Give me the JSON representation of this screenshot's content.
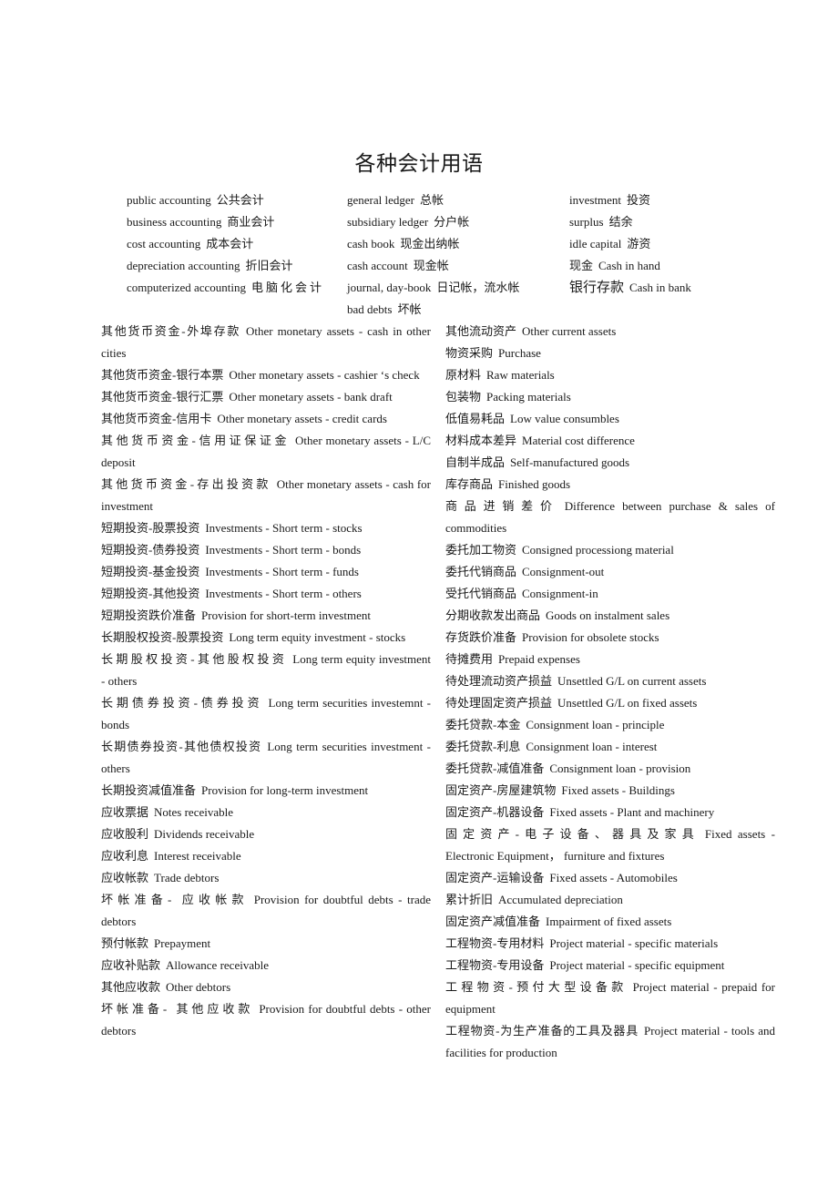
{
  "title": "各种会计用语",
  "top_terms": {
    "col1": [
      {
        "en": "public accounting",
        "zh": "公共会计"
      },
      {
        "en": "business accounting",
        "zh": "商业会计"
      },
      {
        "en": "cost accounting",
        "zh": "成本会计"
      },
      {
        "en": "depreciation accounting",
        "zh": "折旧会计"
      },
      {
        "en": "computerized accounting",
        "zh": "电脑化会计"
      }
    ],
    "col2": [
      {
        "en": "general ledger",
        "zh": "总帐"
      },
      {
        "en": "subsidiary ledger",
        "zh": "分户帐"
      },
      {
        "en": "cash book",
        "zh": "现金出纳帐"
      },
      {
        "en": "cash account",
        "zh": "现金帐"
      },
      {
        "en": "journal, day-book",
        "zh": "日记帐，流水帐"
      },
      {
        "en": "bad debts",
        "zh": "坏帐"
      }
    ],
    "col3": [
      {
        "en": "investment",
        "zh": "投资"
      },
      {
        "en": "surplus",
        "zh": "结余"
      },
      {
        "en": "idle capital",
        "zh": "游资"
      },
      {
        "zh": "现金",
        "en": "Cash in hand"
      },
      {
        "zh": "银行存款",
        "en": "Cash in bank"
      }
    ]
  },
  "left_entries": [
    {
      "zh": "其他货币资金-外埠存款",
      "en": "Other monetary assets - cash in other cities"
    },
    {
      "zh": "其他货币资金-银行本票",
      "en": "Other monetary assets - cashier ‘s check"
    },
    {
      "zh": "其他货币资金-银行汇票",
      "en": "Other monetary assets - bank draft"
    },
    {
      "zh": "其他货币资金-信用卡",
      "en": "Other monetary assets - credit cards"
    },
    {
      "zh": "其他货币资金-信用证保证金",
      "en": "Other monetary assets - L/C deposit"
    },
    {
      "zh": "其他货币资金-存出投资款",
      "en": "Other monetary assets - cash for investment"
    },
    {
      "zh": "短期投资-股票投资",
      "en": "Investments - Short term - stocks"
    },
    {
      "zh": "短期投资-债券投资",
      "en": "Investments - Short term - bonds"
    },
    {
      "zh": "短期投资-基金投资",
      "en": "Investments - Short term - funds"
    },
    {
      "zh": "短期投资-其他投资",
      "en": "Investments - Short term - others"
    },
    {
      "zh": "短期投资跌价准备",
      "en": "Provision for short-term investment"
    },
    {
      "zh": "长期股权投资-股票投资",
      "en": "Long term equity investment - stocks"
    },
    {
      "zh": "长期股权投资-其他股权投资",
      "en": "Long term equity investment - others"
    },
    {
      "zh": "长期债券投资-债券投资",
      "en": "Long term securities investemnt - bonds"
    },
    {
      "zh": "长期债券投资-其他债权投资",
      "en": "Long term securities investment - others"
    },
    {
      "zh": "长期投资减值准备",
      "en": "Provision for long-term investment"
    },
    {
      "zh": "应收票据",
      "en": "Notes receivable"
    },
    {
      "zh": "应收股利",
      "en": "Dividends receivable"
    },
    {
      "zh": "应收利息",
      "en": "Interest receivable"
    },
    {
      "zh": "应收帐款",
      "en": "Trade debtors"
    },
    {
      "zh": "坏帐准备- 应收帐款",
      "en": "Provision for doubtful debts - trade debtors"
    },
    {
      "zh": "预付帐款",
      "en": "Prepayment"
    },
    {
      "zh": "应收补贴款",
      "en": "Allowance receivable"
    },
    {
      "zh": "其他应收款",
      "en": "Other debtors"
    },
    {
      "zh": "坏帐准备- 其他应收款",
      "en": "Provision for doubtful debts - other debtors"
    }
  ],
  "right_entries": [
    {
      "zh": "其他流动资产",
      "en": "Other current assets"
    },
    {
      "zh": "物资采购",
      "en": "Purchase"
    },
    {
      "zh": "原材料",
      "en": "Raw materials"
    },
    {
      "zh": "包装物",
      "en": "Packing materials"
    },
    {
      "zh": "低值易耗品",
      "en": "Low value consumbles"
    },
    {
      "zh": "材料成本差异",
      "en": "Material cost difference"
    },
    {
      "zh": "自制半成品",
      "en": "Self-manufactured goods"
    },
    {
      "zh": "库存商品",
      "en": "Finished goods"
    },
    {
      "zh": "商品进销差价",
      "en": "Difference between purchase & sales of commodities"
    },
    {
      "zh": "委托加工物资",
      "en": "Consigned processiong material"
    },
    {
      "zh": "委托代销商品",
      "en": "Consignment-out"
    },
    {
      "zh": "受托代销商品",
      "en": "Consignment-in"
    },
    {
      "zh": "分期收款发出商品",
      "en": "Goods on instalment sales"
    },
    {
      "zh": "存货跌价准备",
      "en": "Provision for obsolete stocks"
    },
    {
      "zh": "待摊费用",
      "en": "Prepaid expenses"
    },
    {
      "zh": "待处理流动资产损益",
      "en": "Unsettled G/L on current assets"
    },
    {
      "zh": "待处理固定资产损益",
      "en": "Unsettled G/L on fixed assets"
    },
    {
      "zh": "委托贷款-本金",
      "en": "Consignment loan - principle"
    },
    {
      "zh": "委托贷款-利息",
      "en": "Consignment loan - interest"
    },
    {
      "zh": "委托贷款-减值准备",
      "en": "Consignment loan - provision"
    },
    {
      "zh": "固定资产-房屋建筑物",
      "en": "Fixed assets - Buildings"
    },
    {
      "zh": "固定资产-机器设备",
      "en": "Fixed assets - Plant and machinery"
    },
    {
      "zh": "固定资产-电子设备、器具及家具",
      "en": "Fixed assets - Electronic Equipment，  furniture and fixtures"
    },
    {
      "zh": "固定资产-运输设备",
      "en": "Fixed assets - Automobiles"
    },
    {
      "zh": "累计折旧",
      "en": "Accumulated depreciation"
    },
    {
      "zh": "固定资产减值准备",
      "en": "Impairment of fixed assets"
    },
    {
      "zh": "工程物资-专用材料",
      "en": "Project material - specific materials"
    },
    {
      "zh": "工程物资-专用设备",
      "en": "Project material - specific equipment"
    },
    {
      "zh": "工程物资-预付大型设备款",
      "en": "Project material - prepaid for equipment"
    },
    {
      "zh": "工程物资-为生产准备的工具及器具",
      "en": "Project material - tools and facilities for production"
    }
  ]
}
